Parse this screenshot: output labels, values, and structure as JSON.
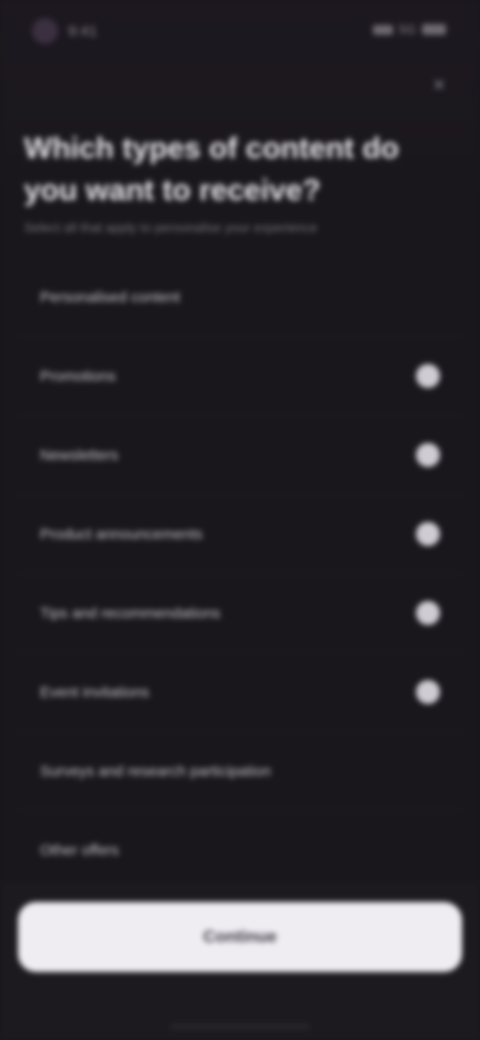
{
  "status_bar": {
    "time": "9:41",
    "right_text": "5G"
  },
  "header": {
    "close_glyph": "×",
    "title": "Which types of content do you want to receive?",
    "subtitle": "Select all that apply to personalise your experience"
  },
  "options": [
    {
      "label": "Personalised content",
      "selected": false
    },
    {
      "label": "Promotions",
      "selected": true
    },
    {
      "label": "Newsletters",
      "selected": true
    },
    {
      "label": "Product announcements",
      "selected": true
    },
    {
      "label": "Tips and recommendations",
      "selected": true
    },
    {
      "label": "Event invitations",
      "selected": true
    },
    {
      "label": "Surveys and research participation",
      "selected": false
    },
    {
      "label": "Other offers",
      "selected": false
    }
  ],
  "footer": {
    "continue_label": "Continue"
  },
  "colors": {
    "background": "#19171b",
    "button": "#efedf1",
    "check": "#d0ccd3"
  }
}
